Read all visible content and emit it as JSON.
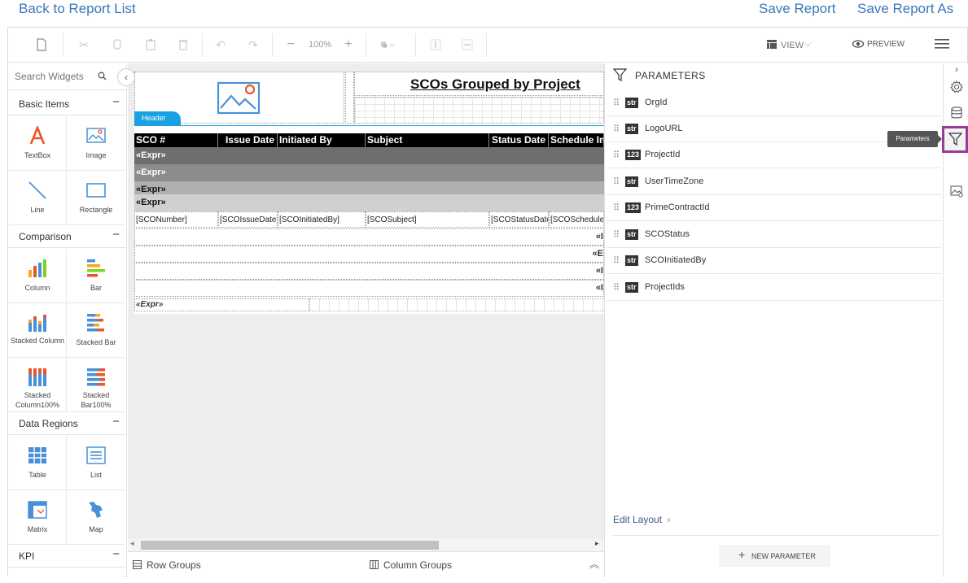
{
  "top_links": {
    "back": "Back to Report List",
    "save": "Save Report",
    "save_as": "Save Report As"
  },
  "toolbar": {
    "zoom": "100%",
    "view_label": "VIEW",
    "preview_label": "PREVIEW"
  },
  "widgets": {
    "search_placeholder": "Search Widgets",
    "categories": [
      {
        "label": "Basic Items",
        "items": [
          "TextBox",
          "Image",
          "Line",
          "Rectangle"
        ]
      },
      {
        "label": "Comparison",
        "items": [
          "Column",
          "Bar",
          "Stacked Column",
          "Stacked Bar",
          "Stacked Column100%",
          "Stacked Bar100%"
        ]
      },
      {
        "label": "Data Regions",
        "items": [
          "Table",
          "List",
          "Matrix",
          "Map"
        ]
      },
      {
        "label": "KPI",
        "items": []
      }
    ],
    "collapse_symbol": "−"
  },
  "report": {
    "title": "SCOs Grouped by Project",
    "header_tab": "Header",
    "columns": [
      "SCO #",
      "Issue Date",
      "Initiated By",
      "Subject",
      "Status Date",
      "Schedule Im"
    ],
    "group_rows": [
      "«Expr»",
      "«Expr»",
      "«Expr»",
      "«Expr»"
    ],
    "detail_cells": [
      "[SCONumber]",
      "[SCOIssueDate]",
      "[SCOInitiatedBy]",
      "[SCOSubject]",
      "[SCOStatusDate]",
      "[SCOScheduleI"
    ],
    "footer_rows": [
      "«I",
      "«E",
      "«I",
      "«I"
    ],
    "footer_expr": "«Expr»"
  },
  "group_bar": {
    "row_groups": "Row Groups",
    "column_groups": "Column Groups"
  },
  "parameters": {
    "title": "PARAMETERS",
    "items": [
      {
        "type": "str",
        "name": "OrgId"
      },
      {
        "type": "str",
        "name": "LogoURL"
      },
      {
        "type": "123",
        "name": "ProjectId"
      },
      {
        "type": "str",
        "name": "UserTimeZone"
      },
      {
        "type": "123",
        "name": "PrimeContractId"
      },
      {
        "type": "str",
        "name": "SCOStatus"
      },
      {
        "type": "str",
        "name": "SCOInitiatedBy"
      },
      {
        "type": "str",
        "name": "ProjectIds"
      }
    ],
    "edit_layout": "Edit Layout",
    "new_parameter": "NEW PARAMETER"
  },
  "side_strip": {
    "tooltip": "Parameters"
  },
  "colors": {
    "link": "#3a78b5",
    "header_tab": "#1aa1e1",
    "active_strip": "#9b3a9b",
    "group_row_1": "#6e6e6e",
    "group_row_2": "#8c8c8c",
    "group_row_3": "#b0b0b0",
    "group_row_4": "#d0d0d0"
  }
}
